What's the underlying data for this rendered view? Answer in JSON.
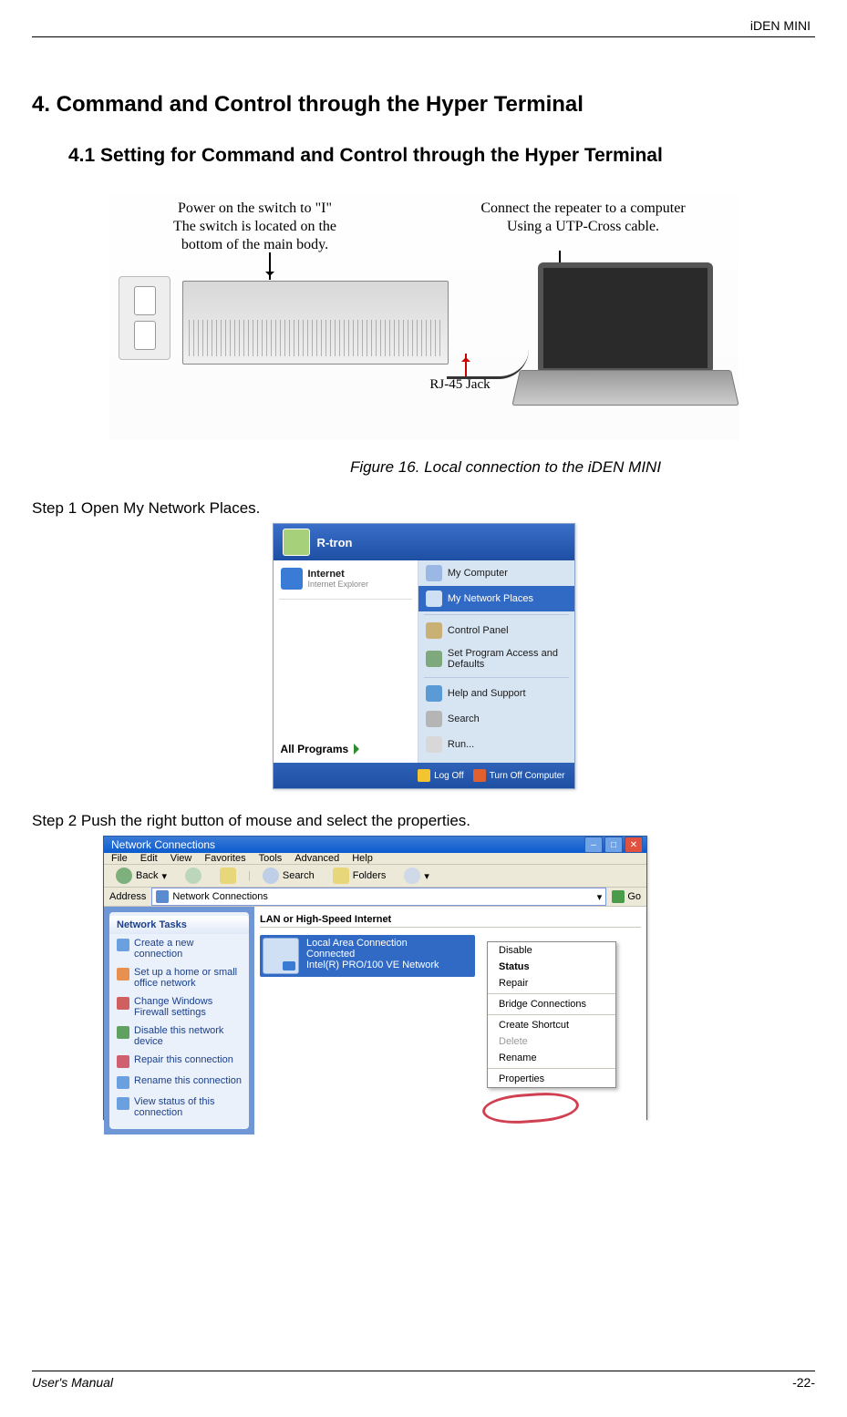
{
  "header": {
    "doc_title": "iDEN MINI"
  },
  "section": {
    "title": "4.  Command and Control through the Hyper Terminal",
    "subtitle": "4.1 Setting for Command and Control through the Hyper Terminal"
  },
  "figure1": {
    "callout_left": "Power on the switch to \"I\"\nThe switch is located on the\nbottom of the main body.",
    "callout_right": "Connect the repeater to a computer\nUsing a UTP-Cross  cable.",
    "rj45_label": "RJ-45 Jack",
    "caption": "Figure 16.     Local connection to the iDEN MINI"
  },
  "step1": {
    "text": "Step 1 Open My Network Places."
  },
  "startmenu": {
    "user": "R-tron",
    "left": {
      "internet": {
        "title": "Internet",
        "sub": "Internet Explorer"
      },
      "all_programs": "All Programs"
    },
    "right": {
      "items": [
        "My Computer",
        "My Network Places",
        "Control Panel",
        "Set Program Access and Defaults",
        "Help and Support",
        "Search",
        "Run..."
      ]
    },
    "footer": {
      "logoff": "Log Off",
      "turnoff": "Turn Off Computer"
    }
  },
  "step2": {
    "text": "Step 2 Push the right button of mouse and select the properties."
  },
  "netwin": {
    "title": "Network Connections",
    "menu": [
      "File",
      "Edit",
      "View",
      "Favorites",
      "Tools",
      "Advanced",
      "Help"
    ],
    "toolbar": {
      "back": "Back",
      "search": "Search",
      "folders": "Folders"
    },
    "address_label": "Address",
    "address_value": "Network Connections",
    "go": "Go",
    "sidebar": {
      "header": "Network Tasks",
      "links": [
        "Create a new connection",
        "Set up a home or small office network",
        "Change Windows Firewall settings",
        "Disable this network device",
        "Repair this connection",
        "Rename this connection",
        "View status of this connection"
      ]
    },
    "group_header": "LAN or High-Speed Internet",
    "connection": {
      "name": "Local Area Connection",
      "status": "Connected",
      "device": "Intel(R) PRO/100 VE Network"
    },
    "context_menu": [
      {
        "label": "Disable",
        "bold": false
      },
      {
        "label": "Status",
        "bold": true
      },
      {
        "label": "Repair",
        "bold": false
      },
      {
        "sep": true
      },
      {
        "label": "Bridge Connections",
        "bold": false
      },
      {
        "sep": true
      },
      {
        "label": "Create Shortcut",
        "bold": false
      },
      {
        "label": "Delete",
        "disabled": true
      },
      {
        "label": "Rename",
        "bold": false
      },
      {
        "sep": true
      },
      {
        "label": "Properties",
        "bold": false
      }
    ],
    "winbuttons": {
      "min": "–",
      "max": "□",
      "close": "✕"
    }
  },
  "footer": {
    "left": "User's Manual",
    "right": "-22-"
  }
}
